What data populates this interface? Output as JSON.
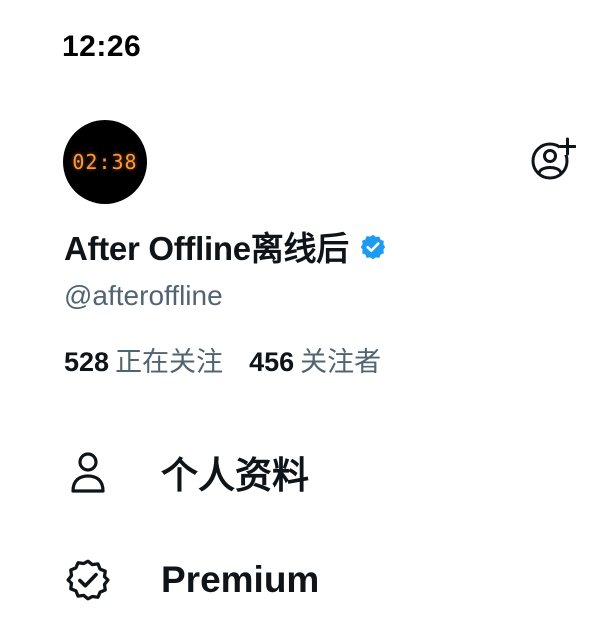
{
  "status_bar": {
    "time": "12:26"
  },
  "profile": {
    "avatar_clock_text": "02:38",
    "display_name": "After Offline离线后",
    "verified_icon": "verified-badge-icon",
    "handle": "@afteroffline",
    "following_count": "528",
    "following_label": "正在关注",
    "followers_count": "456",
    "followers_label": "关注者"
  },
  "header": {
    "add_follow_icon": "person-add-icon"
  },
  "menu": {
    "items": [
      {
        "label": "个人资料",
        "icon": "person-icon"
      },
      {
        "label": "Premium",
        "icon": "premium-badge-icon"
      }
    ]
  },
  "colors": {
    "text_primary": "#0f1419",
    "text_secondary": "#536471",
    "verified_blue": "#1d9bf0",
    "avatar_bg": "#000000",
    "avatar_clock": "#ff9a3c"
  }
}
